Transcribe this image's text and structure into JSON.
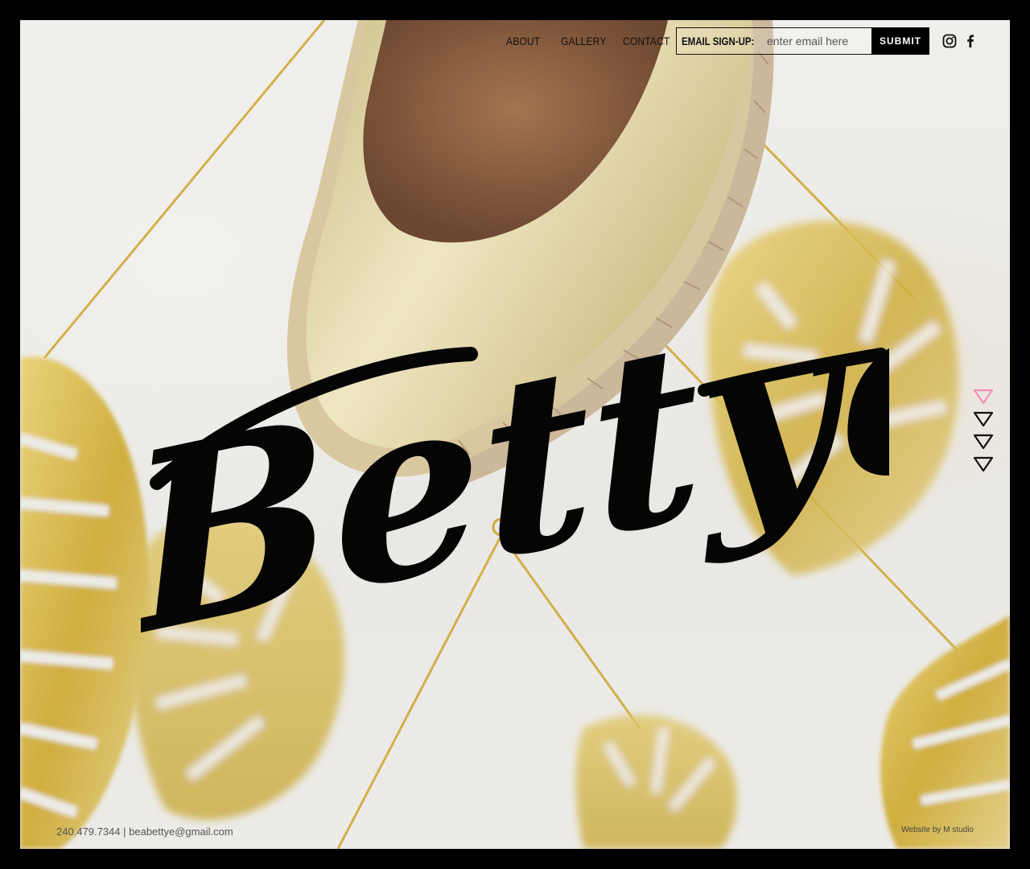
{
  "nav": {
    "about": "ABOUT",
    "gallery": "GALLERY",
    "contact": "CONTACT"
  },
  "signup": {
    "label": "EMAIL SIGN-UP:",
    "placeholder": "enter email here",
    "submit": "SUBMIT"
  },
  "social": [
    "instagram-icon",
    "facebook-icon"
  ],
  "logo": {
    "text": "Bettye"
  },
  "slides": {
    "count": 4,
    "active_index": 0,
    "active_color": "#f08fb8",
    "inactive_color": "#111111"
  },
  "footer": {
    "contact": "240.479.7344 | beabettye@gmail.com",
    "credit": "Website by M studio"
  },
  "colors": {
    "frame": "#000000",
    "gold": "#d7bc4a",
    "shoe": "#d9cfa0"
  }
}
